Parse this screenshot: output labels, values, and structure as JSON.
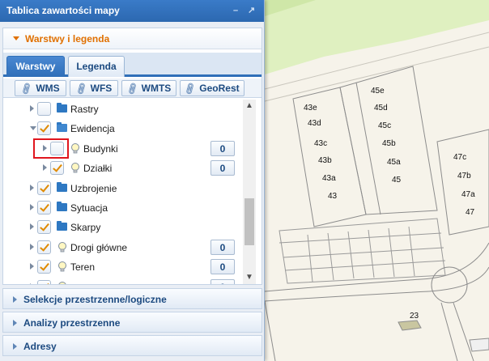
{
  "panel": {
    "title": "Tablica zawartości mapy",
    "controls": [
      "minimize-icon",
      "popout-icon"
    ]
  },
  "accordion": {
    "active": "Warstwy i legenda",
    "closed": [
      "Selekcje przestrzenne/logiczne",
      "Analizy przestrzenne",
      "Adresy"
    ]
  },
  "tabs": [
    {
      "label": "Warstwy",
      "active": true
    },
    {
      "label": "Legenda",
      "active": false
    }
  ],
  "services": [
    "WMS",
    "WFS",
    "WMTS",
    "GeoRest"
  ],
  "tree": [
    {
      "label": "Rastry",
      "checked": false,
      "icon": "folder-icon",
      "expanded": false,
      "level": 0,
      "count": null
    },
    {
      "label": "Ewidencja",
      "checked": true,
      "icon": "folder-open-icon",
      "expanded": true,
      "level": 0,
      "count": null
    },
    {
      "label": "Budynki",
      "checked": false,
      "icon": "bulb-icon",
      "expanded": false,
      "level": 1,
      "count": "0",
      "highlighted": true
    },
    {
      "label": "Działki",
      "checked": true,
      "icon": "bulb-icon",
      "expanded": false,
      "level": 1,
      "count": "0"
    },
    {
      "label": "Uzbrojenie",
      "checked": true,
      "icon": "folder-icon",
      "expanded": false,
      "level": 0,
      "count": null
    },
    {
      "label": "Sytuacja",
      "checked": true,
      "icon": "folder-icon",
      "expanded": false,
      "level": 0,
      "count": null
    },
    {
      "label": "Skarpy",
      "checked": true,
      "icon": "folder-icon",
      "expanded": false,
      "level": 0,
      "count": null
    },
    {
      "label": "Drogi główne",
      "checked": true,
      "icon": "bulb-icon",
      "expanded": false,
      "level": 0,
      "count": "0"
    },
    {
      "label": "Teren",
      "checked": true,
      "icon": "bulb-icon",
      "expanded": false,
      "level": 0,
      "count": "0"
    },
    {
      "label": "",
      "checked": true,
      "icon": "bulb-icon",
      "expanded": false,
      "level": 0,
      "count": "0"
    }
  ],
  "map": {
    "plot_labels": [
      "43e",
      "43d",
      "43c",
      "43b",
      "43a",
      "43",
      "45e",
      "45d",
      "45c",
      "45b",
      "45a",
      "45",
      "47c",
      "47b",
      "47a",
      "47",
      "23"
    ]
  },
  "colors": {
    "accent": "#e07000",
    "header": "#2f6fb8",
    "check": "#e08a00",
    "highlight": "#e0161e",
    "green_area": "#dff0c0"
  }
}
